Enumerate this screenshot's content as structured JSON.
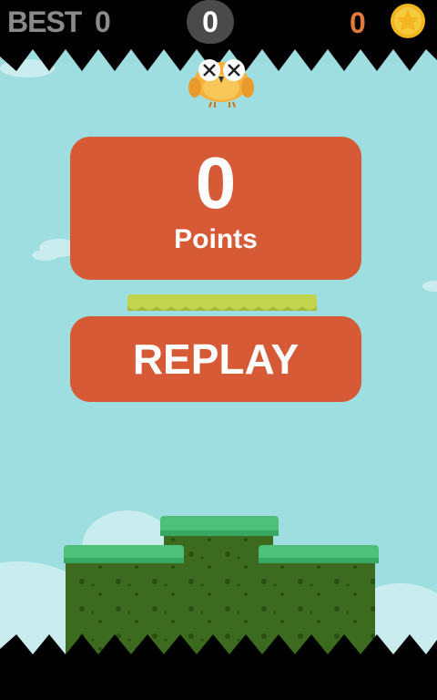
{
  "hud": {
    "best_label": "BEST",
    "best_value": "0",
    "score": "0",
    "coins": "0"
  },
  "game_over": {
    "points_value": "0",
    "points_label": "Points",
    "replay_label": "REPLAY"
  },
  "icons": {
    "coin": "star-coin-icon",
    "bird": "owl-bird-dead"
  },
  "colors": {
    "sky": "#9edde0",
    "panel": "#d65a35",
    "grass": "#4ec07a",
    "dirt": "#3c6b1f",
    "coin": "#f2b420",
    "coin_text": "#e07a3a"
  }
}
